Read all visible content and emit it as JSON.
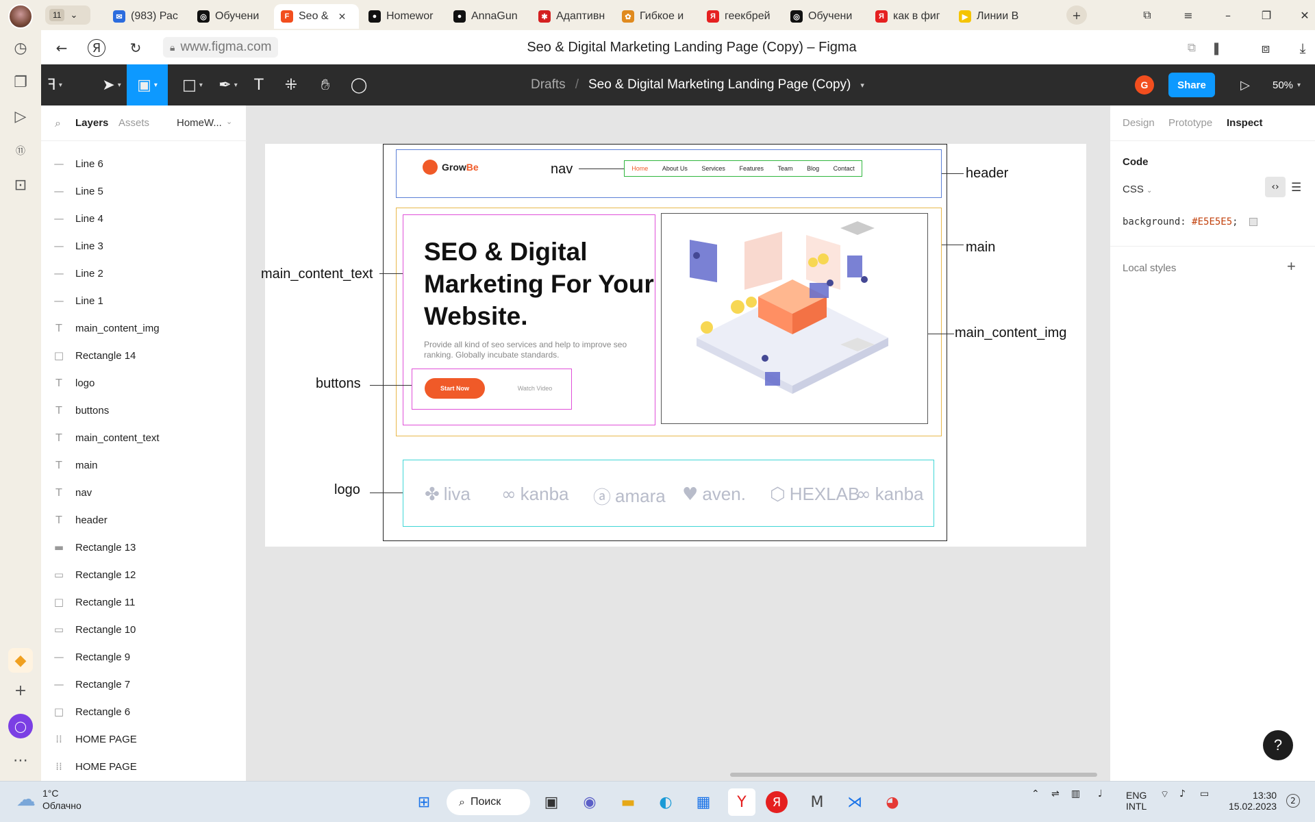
{
  "browser": {
    "tab_count": "11",
    "tabs": [
      {
        "label": "(983) Рас",
        "color": "#2b6cde",
        "glyph": "✉"
      },
      {
        "label": "Обучени",
        "color": "#111111",
        "glyph": "◎"
      },
      {
        "label": "Seo &",
        "color": "#f24e1e",
        "glyph": "F"
      },
      {
        "label": "Homewor",
        "color": "#111111",
        "glyph": "●"
      },
      {
        "label": "AnnaGun",
        "color": "#111111",
        "glyph": "●"
      },
      {
        "label": "Адаптивн",
        "color": "#d42020",
        "glyph": "✱"
      },
      {
        "label": "Гибкое и",
        "color": "#e08a1e",
        "glyph": "✿"
      },
      {
        "label": "геекбрей",
        "color": "#e52020",
        "glyph": "Я"
      },
      {
        "label": "Обучени",
        "color": "#111111",
        "glyph": "◎"
      },
      {
        "label": "как в фиг",
        "color": "#e52020",
        "glyph": "Я"
      },
      {
        "label": "Линии В",
        "color": "#f5c400",
        "glyph": "▶"
      }
    ],
    "url": "www.figma.com",
    "page_title": "Seo & Digital Marketing Landing Page (Copy) – Figma"
  },
  "figma": {
    "breadcrumb_folder": "Drafts",
    "file_name": "Seo & Digital Marketing Landing Page (Copy)",
    "user_initial": "G",
    "share_label": "Share",
    "zoom": "50%"
  },
  "left_panel": {
    "tab_layers": "Layers",
    "tab_assets": "Assets",
    "page_selector": "HomeW...",
    "layers": [
      {
        "name": "Line 6",
        "icon": "—"
      },
      {
        "name": "Line 5",
        "icon": "—"
      },
      {
        "name": "Line 4",
        "icon": "—"
      },
      {
        "name": "Line 3",
        "icon": "—"
      },
      {
        "name": "Line 2",
        "icon": "—"
      },
      {
        "name": "Line 1",
        "icon": "—"
      },
      {
        "name": "main_content_img",
        "icon": "T"
      },
      {
        "name": "Rectangle 14",
        "icon": "□"
      },
      {
        "name": "logo",
        "icon": "T"
      },
      {
        "name": "buttons",
        "icon": "T"
      },
      {
        "name": "main_content_text",
        "icon": "T"
      },
      {
        "name": "main",
        "icon": "T"
      },
      {
        "name": "nav",
        "icon": "T"
      },
      {
        "name": "header",
        "icon": "T"
      },
      {
        "name": "Rectangle 13",
        "icon": "▬"
      },
      {
        "name": "Rectangle 12",
        "icon": "▭"
      },
      {
        "name": "Rectangle 11",
        "icon": "□"
      },
      {
        "name": "Rectangle 10",
        "icon": "▭"
      },
      {
        "name": "Rectangle 9",
        "icon": "—"
      },
      {
        "name": "Rectangle 7",
        "icon": "—"
      },
      {
        "name": "Rectangle 6",
        "icon": "□"
      },
      {
        "name": "HOME PAGE",
        "icon": "⁞⁞"
      },
      {
        "name": "HOME PAGE",
        "icon": "⁞⁞"
      }
    ]
  },
  "canvas": {
    "annotations": {
      "nav": "nav",
      "header": "header",
      "main": "main",
      "main_content_text": "main_content_text",
      "main_content_img": "main_content_img",
      "buttons": "buttons",
      "logo": "logo"
    },
    "outline_colors": {
      "header": "#5b7fd6",
      "main": "#e8b84a",
      "text": "#e04fd8",
      "img": "#555555",
      "nav": "#2fb63d",
      "logos": "#3fd6d6"
    },
    "mockup": {
      "logo_text": "Grow",
      "logo_accent": "Be",
      "nav_items": [
        "Home",
        "About Us",
        "Services",
        "Features",
        "Team",
        "Blog",
        "Contact"
      ],
      "headline": "SEO & Digital Marketing For Your Website.",
      "subtext": "Provide all kind of seo services and help to improve seo ranking. Globally incubate standards.",
      "primary_button": "Start Now",
      "secondary_button": "Watch Video",
      "brands": [
        "liva",
        "kanba",
        "amara",
        "aven.",
        "HEXLAB",
        "kanba"
      ],
      "accent": "#f05a28"
    }
  },
  "right_panel": {
    "tabs": [
      "Design",
      "Prototype",
      "Inspect"
    ],
    "active_tab": "Inspect",
    "code_heading": "Code",
    "language": "CSS",
    "code_property": "background:",
    "code_value": "#E5E5E5",
    "code_end": ";",
    "local_styles": "Local styles"
  },
  "taskbar": {
    "temperature": "1°C",
    "weather": "Облачно",
    "search_label": "Поиск",
    "lang_top": "ENG",
    "lang_bottom": "INTL",
    "time": "13:30",
    "date": "15.02.2023",
    "notifications": "2"
  }
}
